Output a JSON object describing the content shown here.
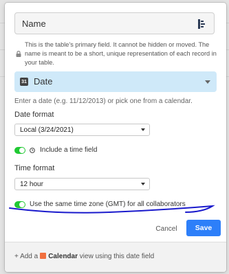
{
  "field_name": {
    "value": "Name"
  },
  "primary_note": "This is the table’s primary field. It cannot be hidden or moved. The name is meant to be a short, unique representation of each record in your table.",
  "field_type": {
    "label": "Date"
  },
  "date_hint": "Enter a date (e.g. 11/12/2013) or pick one from a calendar.",
  "date_format": {
    "label": "Date format",
    "selected": "Local (3/24/2021)"
  },
  "include_time": {
    "label": "Include a time field",
    "enabled": true
  },
  "time_format": {
    "label": "Time format",
    "selected": "12 hour"
  },
  "same_timezone": {
    "label": "Use the same time zone (GMT) for all collaborators",
    "enabled": true
  },
  "buttons": {
    "cancel": "Cancel",
    "save": "Save"
  },
  "footer": {
    "prefix": "+ Add a",
    "calendar": "Calendar",
    "suffix": "view using this date field"
  },
  "colors": {
    "toggle_on": "#20c933",
    "primary": "#2d7ff9",
    "type_bar": "#cfe9f9",
    "annotation": "#1a1acc"
  }
}
